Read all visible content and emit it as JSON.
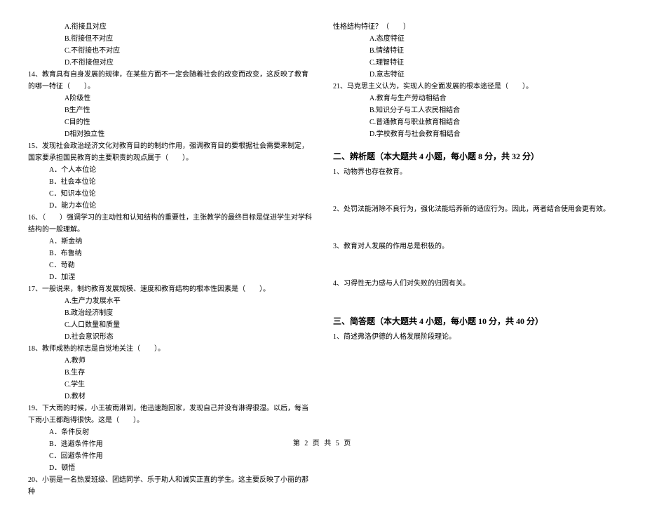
{
  "left": {
    "q13_opts": [
      "A.衔接且对应",
      "B.衔接但不对应",
      "C.不衔接也不对应",
      "D.不衔接但对应"
    ],
    "q14": "14、教育具有自身发展的规律，在某些方面不一定会随着社会的改变而改变，这反映了教育的哪一特征（　　）。",
    "q14_opts": [
      "A阶级性",
      "B生产性",
      "C目的性",
      "D相对独立性"
    ],
    "q15": "15、发现社会政治经济文化对教育目的的制约作用，强调教育目的要根据社会需要来制定，国家要承担国民教育的主要职责的观点属于（　　）。",
    "q15_opts": [
      "A．个人本位论",
      "B．社会本位论",
      "C．知识本位论",
      "D．能力本位论"
    ],
    "q16": "16、（　　）强调学习的主动性和认知结构的重要性，主张教学的最终目标是促进学生对学科结构的一般理解。",
    "q16_opts": [
      "A．斯金纳",
      "B．布鲁纳",
      "C．苛勒",
      "D．加涅"
    ],
    "q17": "17、一般说来，制约教育发展规模、速度和教育结构的根本性因素是（　　）。",
    "q17_opts": [
      "A.生产力发展水平",
      "B.政治经济制度",
      "C.人口数量和质量",
      "D.社会意识形态"
    ],
    "q18": "18、教师成熟的标志是自觉地关注（　　）。",
    "q18_opts": [
      "A.教师",
      "B.生存",
      "C.学生",
      "D.教材"
    ],
    "q19": "19、下大雨的时候，小王被雨淋到，他迅速跑回家，发现自己并没有淋得很湿。以后，每当下雨小王都跑得很快。这是（　　）。",
    "q19_opts": [
      "A．条件反射",
      "B．逃避条件作用",
      "C．回避条件作用",
      "D．顿悟"
    ],
    "q20": "20、小丽是一名热爱班级、团结同学、乐于助人和诚实正直的学生。这主要反映了小丽的那种"
  },
  "right": {
    "q20b": "性格结构特征？（　　）",
    "q20_opts": [
      "A.态度特征",
      "B.情绪特征",
      "C.理智特征",
      "D.意志特征"
    ],
    "q21": "21、马克思主义认为，实现人的全面发展的根本途径是（　　）。",
    "q21_opts": [
      "A.教育与生产劳动相结合",
      "B.知识分子与工人农民相结合",
      "C.普通教育与职业教育相结合",
      "D.学校教育与社会教育相结合"
    ],
    "section2_title": "二、辨析题（本大题共 4 小题，每小题 8 分，共 32 分）",
    "s2q1": "1、动物界也存在教育。",
    "s2q2": "2、处罚法能消除不良行为，强化法能培养新的适应行为。因此，两者结合使用会更有效。",
    "s2q3": "3、教育对人发展的作用总是积极的。",
    "s2q4": "4、习得性无力感与人们对失败的归因有关。",
    "section3_title": "三、简答题（本大题共 4 小题，每小题 10 分，共 40 分）",
    "s3q1": "1、简述弗洛伊德的人格发展阶段理论。"
  },
  "footer": "第 2 页 共 5 页"
}
